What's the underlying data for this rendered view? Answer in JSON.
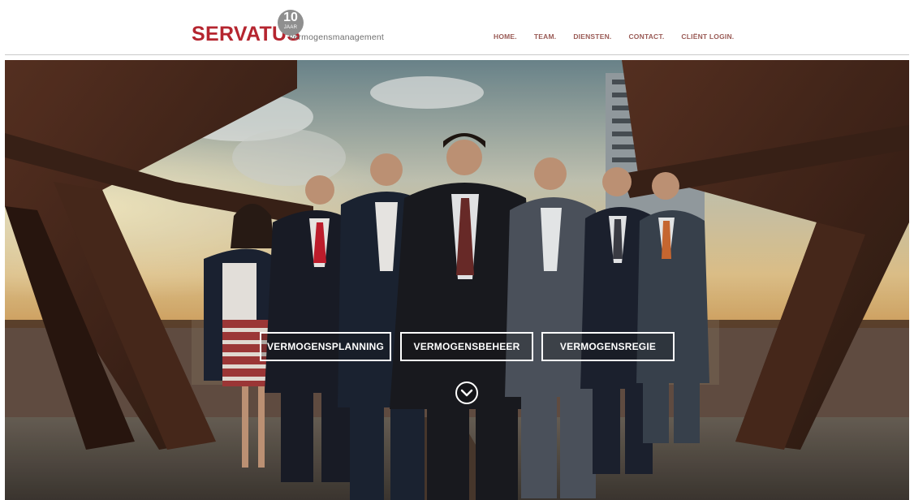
{
  "header": {
    "logo": {
      "wordmark": "SERVATUS",
      "tagline": "vermogensmanagement",
      "badge_number": "10",
      "badge_label": "JAAR"
    },
    "nav": [
      {
        "label": "HOME."
      },
      {
        "label": "TEAM."
      },
      {
        "label": "DIENSTEN."
      },
      {
        "label": "CONTACT."
      },
      {
        "label": "CLIËNT LOGIN."
      }
    ]
  },
  "hero": {
    "image_icon": "team-photo-image",
    "services": [
      {
        "label": "VERMOGENSPLANNING"
      },
      {
        "label": "VERMOGENSBEHEER"
      },
      {
        "label": "VERMOGENSREGIE"
      }
    ],
    "scroll_icon": "chevron-down-icon"
  },
  "colors": {
    "brand_red": "#b5252f",
    "nav_text": "#9a5b56",
    "badge_gray": "#8f8f8f"
  }
}
